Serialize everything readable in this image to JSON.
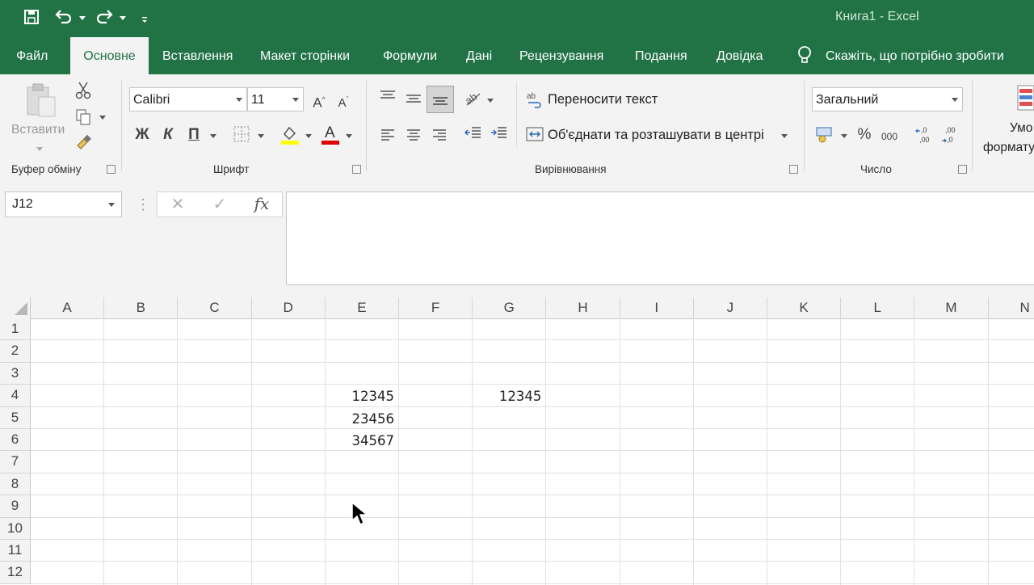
{
  "window": {
    "title": "Книга1  -  Excel"
  },
  "quick_access": {
    "save": "save-icon",
    "undo": "undo-icon",
    "redo": "redo-icon",
    "customize": "customize-icon"
  },
  "tabs": [
    {
      "label": "Файл"
    },
    {
      "label": "Основне",
      "active": true
    },
    {
      "label": "Вставлення"
    },
    {
      "label": "Макет сторінки"
    },
    {
      "label": "Формули"
    },
    {
      "label": "Дані"
    },
    {
      "label": "Рецензування"
    },
    {
      "label": "Подання"
    },
    {
      "label": "Довідка"
    }
  ],
  "tell_me": "Скажіть, що потрібно зробити",
  "ribbon": {
    "clipboard": {
      "paste_label": "Вставити",
      "group_label": "Буфер обміну"
    },
    "font": {
      "family": "Calibri",
      "size": "11",
      "bold": "Ж",
      "italic": "К",
      "underline": "П",
      "group_label": "Шрифт"
    },
    "alignment": {
      "wrap_text": "Переносити текст",
      "merge_center": "Об'єднати та розташувати в центрі",
      "group_label": "Вирівнювання"
    },
    "number": {
      "format": "Загальний",
      "percent": "%",
      "thousands": "000",
      "group_label": "Число"
    },
    "styles": {
      "cond_format_line1": "Умо",
      "cond_format_line2": "формату"
    }
  },
  "formula_bar": {
    "name_box": "J12",
    "cancel": "✕",
    "enter": "✓",
    "fx": "fx",
    "value": ""
  },
  "sheet": {
    "columns": [
      "A",
      "B",
      "C",
      "D",
      "E",
      "F",
      "G",
      "H",
      "I",
      "J",
      "K",
      "L",
      "M",
      "N"
    ],
    "rows": [
      "1",
      "2",
      "3",
      "4",
      "5",
      "6",
      "7",
      "8",
      "9",
      "10",
      "11",
      "12"
    ],
    "cells": [
      {
        "ref": "E4",
        "value": "12345"
      },
      {
        "ref": "E5",
        "value": "23456"
      },
      {
        "ref": "E6",
        "value": "34567"
      },
      {
        "ref": "G4",
        "value": "12345"
      }
    ]
  },
  "colors": {
    "accent": "#217346",
    "ribbon_bg": "#f3f3f3",
    "fill_color": "#ffff00",
    "font_color": "#e00000"
  }
}
